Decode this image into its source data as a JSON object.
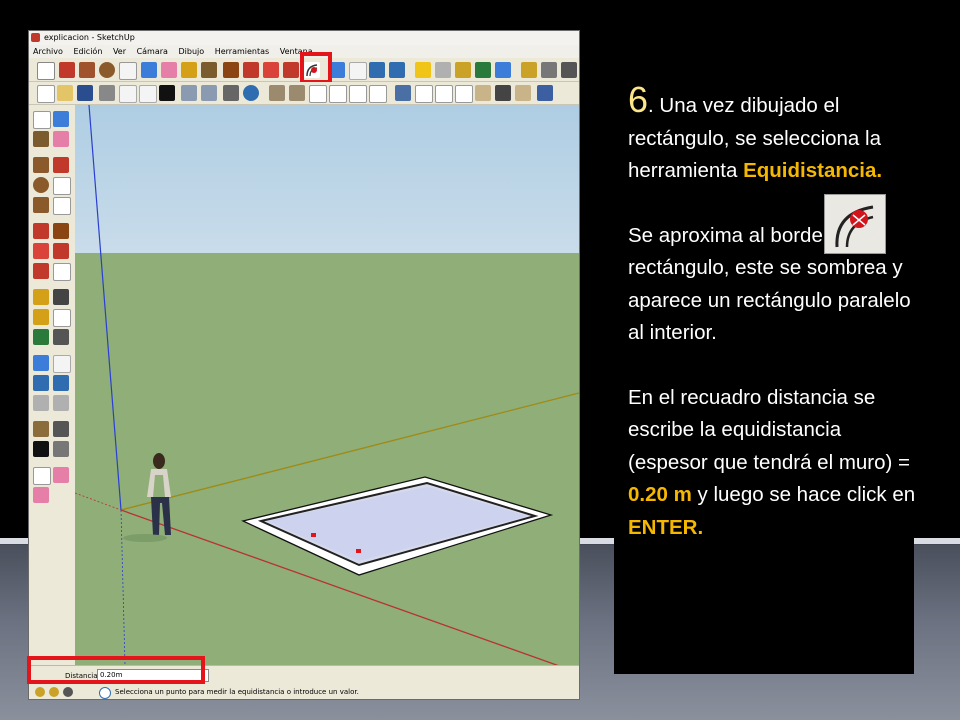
{
  "window": {
    "title": "explicacion - SketchUp",
    "menu": [
      "Archivo",
      "Edición",
      "Ver",
      "Cámara",
      "Dibujo",
      "Herramientas",
      "Ventana"
    ]
  },
  "status": {
    "distance_label": "Distancia",
    "distance_value": "0.20m",
    "hint": "Selecciona un punto para medir la equidistancia o introduce un valor."
  },
  "instructions": {
    "step_number": "6",
    "p1_a": ". Una vez dibujado el rectángulo, se selecciona la herramienta ",
    "p1_tool": "Equidistancia.",
    "p2": "Se aproxima  al borde del rectángulo, este  se sombrea y aparece un rectángulo paralelo al interior.",
    "p3_a": "En  el recuadro distancia se escribe  la equidistancia (espesor que tendrá el muro) = ",
    "p3_value": "0.20 m",
    "p3_b": " y luego  se hace click en ",
    "p3_key": "ENTER."
  },
  "colors": {
    "highlight": "#e3141a",
    "accent_text": "#f5b700",
    "ground": "#8fae78",
    "sky": "#aecde3"
  },
  "icons": {
    "offset_tool": "offset-icon"
  }
}
